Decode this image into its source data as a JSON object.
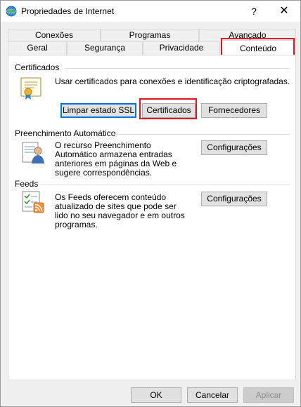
{
  "window": {
    "title": "Propriedades de Internet",
    "help_label": "?",
    "close_label": "✕"
  },
  "tabs": {
    "back": [
      "Conexões",
      "Programas",
      "Avançado"
    ],
    "front": [
      "Geral",
      "Segurança",
      "Privacidade",
      "Conteúdo"
    ],
    "active": "Conteúdo"
  },
  "certificates": {
    "section_title": "Certificados",
    "description": "Usar certificados para conexões e identificação criptografadas.",
    "clear_ssl_label": "Limpar estado SSL",
    "certificates_label": "Certificados",
    "publishers_label": "Fornecedores"
  },
  "autocomplete": {
    "section_title": "Preenchimento Automático",
    "description": "O recurso Preenchimento Automático armazena entradas anteriores em páginas da Web e sugere correspondências.",
    "settings_label": "Configurações"
  },
  "feeds": {
    "section_title": "Feeds",
    "description": "Os Feeds oferecem conteúdo atualizado de sites que pode ser lido no seu navegador e em outros programas.",
    "settings_label": "Configurações"
  },
  "footer": {
    "ok_label": "OK",
    "cancel_label": "Cancelar",
    "apply_label": "Aplicar"
  },
  "colors": {
    "highlight": "#e81123",
    "default_button_border": "#0078d7"
  }
}
